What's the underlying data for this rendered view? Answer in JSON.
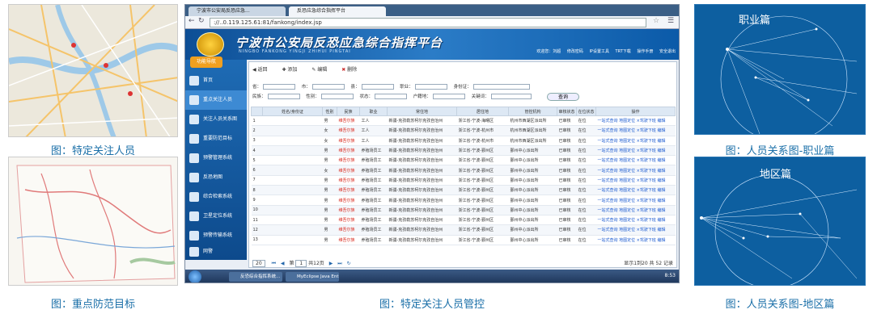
{
  "captions": {
    "top_left": "图：特定关注人员",
    "bottom_left": "图：重点防范目标",
    "center": "图：特定关注人员管控",
    "top_right": "图：人员关系图-职业篇",
    "bottom_right": "图：人员关系图-地区篇"
  },
  "relation_top": {
    "title": "职业篇"
  },
  "relation_bottom": {
    "title": "地区篇"
  },
  "browser": {
    "tabs": [
      "宁波市公安局反恐应急...",
      "反恐应急综合指挥平台"
    ],
    "url": "://..0.119.125.61:81/fankong/index.jsp"
  },
  "app": {
    "title": "宁波市公安局反恐应急综合指挥平台",
    "subtitle": "NINGBO FANKONG YINGJI ZHIHUI PINGTAI",
    "top_nav": [
      "欢迎您：刘超",
      "修改密码",
      "IP设置工具",
      "TRT下载",
      "操作手册",
      "安全退出"
    ],
    "sidebar_header": "功能导航",
    "sidebar": [
      "首页",
      "重点关注人员",
      "关注人员关系图",
      "重要防范目标",
      "预警管理系统",
      "反恐地图",
      "综合检索系统",
      "卫星定位系统",
      "预警传输系统",
      "网警"
    ]
  },
  "toolbar": {
    "back": "返回",
    "add": "添加",
    "edit": "编辑",
    "delete": "删除"
  },
  "filters": {
    "row1": [
      "省：",
      "市：",
      "县：",
      "职业：",
      "身份证："
    ],
    "row2": [
      "民族：",
      "性别：",
      "状态：",
      "户籍地：",
      "关键词："
    ],
    "query": "查询"
  },
  "table": {
    "headers": [
      "",
      "姓名/身份证",
      "性别",
      "民族",
      "职业",
      "常住地",
      "居住地",
      "管控机构",
      "审核状态",
      "在位状态",
      "操作"
    ],
    "rows": [
      [
        "1",
        "",
        "男",
        "维吾尔族",
        "工人",
        "新疆-克孜勒苏柯尔克孜自治州",
        "浙江省-宁波-海曙区",
        "杭州市西湖区派出所",
        "已审核",
        "在位",
        "一站式查询 地图定位 ×驾驶下班 编辑"
      ],
      [
        "2",
        "",
        "女",
        "维吾尔族",
        "工人",
        "新疆-克孜勒苏柯尔克孜自治州",
        "浙江省-宁波-杭州市",
        "杭州市西湖区派出所",
        "已审核",
        "在位",
        "一站式查询 地图定位 ×驾驶下班 编辑"
      ],
      [
        "3",
        "",
        "女",
        "维吾尔族",
        "工人",
        "新疆-克孜勒苏柯尔克孜自治州",
        "浙江省-宁波-杭州市",
        "杭州市西湖区派出所",
        "已审核",
        "在位",
        "一站式查询 地图定位 ×驾驶下班 编辑"
      ],
      [
        "4",
        "",
        "男",
        "维吾尔族",
        "养殖场员工",
        "新疆-克孜勒苏柯尔克孜自治州",
        "浙江省-宁波-鄞州区",
        "鄞州中心派出所",
        "已审核",
        "在位",
        "一站式查询 地图定位 ×驾驶下班 编辑"
      ],
      [
        "5",
        "",
        "男",
        "维吾尔族",
        "养殖场员工",
        "新疆-克孜勒苏柯尔克孜自治州",
        "浙江省-宁波-鄞州区",
        "鄞州中心派出所",
        "已审核",
        "在位",
        "一站式查询 地图定位 ×驾驶下班 编辑"
      ],
      [
        "6",
        "",
        "女",
        "维吾尔族",
        "养殖场员工",
        "新疆-克孜勒苏柯尔克孜自治州",
        "浙江省-宁波-鄞州区",
        "鄞州中心派出所",
        "已审核",
        "在位",
        "一站式查询 地图定位 ×驾驶下班 编辑"
      ],
      [
        "7",
        "",
        "男",
        "维吾尔族",
        "养殖场员工",
        "新疆-克孜勒苏柯尔克孜自治州",
        "浙江省-宁波-鄞州区",
        "鄞州中心派出所",
        "已审核",
        "在位",
        "一站式查询 地图定位 ×驾驶下班 编辑"
      ],
      [
        "8",
        "",
        "男",
        "维吾尔族",
        "养殖场员工",
        "新疆-克孜勒苏柯尔克孜自治州",
        "浙江省-宁波-鄞州区",
        "鄞州中心派出所",
        "已审核",
        "在位",
        "一站式查询 地图定位 ×驾驶下班 编辑"
      ],
      [
        "9",
        "",
        "男",
        "维吾尔族",
        "养殖场员工",
        "新疆-克孜勒苏柯尔克孜自治州",
        "浙江省-宁波-鄞州区",
        "鄞州中心派出所",
        "已审核",
        "在位",
        "一站式查询 地图定位 ×驾驶下班 编辑"
      ],
      [
        "10",
        "",
        "男",
        "维吾尔族",
        "养殖场员工",
        "新疆-克孜勒苏柯尔克孜自治州",
        "浙江省-宁波-鄞州区",
        "鄞州中心派出所",
        "已审核",
        "在位",
        "一站式查询 地图定位 ×驾驶下班 编辑"
      ],
      [
        "11",
        "",
        "男",
        "维吾尔族",
        "养殖场员工",
        "新疆-克孜勒苏柯尔克孜自治州",
        "浙江省-宁波-鄞州区",
        "鄞州中心派出所",
        "已审核",
        "在位",
        "一站式查询 地图定位 ×驾驶下班 编辑"
      ],
      [
        "12",
        "",
        "男",
        "维吾尔族",
        "养殖场员工",
        "新疆-克孜勒苏柯尔克孜自治州",
        "浙江省-宁波-鄞州区",
        "鄞州中心派出所",
        "已审核",
        "在位",
        "一站式查询 地图定位 ×驾驶下班 编辑"
      ],
      [
        "13",
        "",
        "男",
        "维吾尔族",
        "养殖场员工",
        "新疆-克孜勒苏柯尔克孜自治州",
        "浙江省-宁波-鄞州区",
        "鄞州中心派出所",
        "已审核",
        "在位",
        "一站式查询 地图定位 ×驾驶下班 编辑"
      ]
    ]
  },
  "pager": {
    "size": "20",
    "page_label": "第",
    "page": "1",
    "total_label": "共12页",
    "info": "显示1到20 共 52 记录"
  },
  "taskbar": {
    "items": [
      "反恐综合指挥系统...",
      "MyEclipse Java Ent..."
    ],
    "time": "8:53"
  }
}
